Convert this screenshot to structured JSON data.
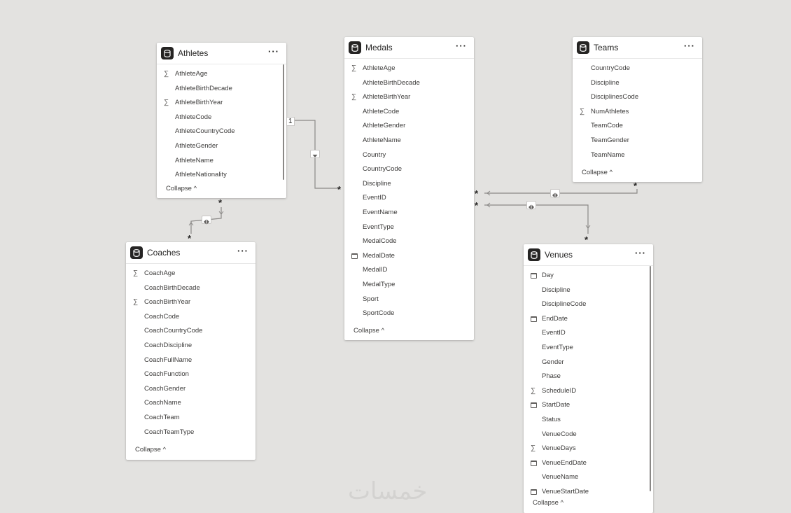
{
  "tables": {
    "athletes": {
      "title": "Athletes",
      "more": "···",
      "collapse": "Collapse",
      "fields": [
        {
          "name": "AthleteAge",
          "icon": "sigma"
        },
        {
          "name": "AthleteBirthDecade",
          "icon": ""
        },
        {
          "name": "AthleteBirthYear",
          "icon": "sigma"
        },
        {
          "name": "AthleteCode",
          "icon": ""
        },
        {
          "name": "AthleteCountryCode",
          "icon": ""
        },
        {
          "name": "AthleteGender",
          "icon": ""
        },
        {
          "name": "AthleteName",
          "icon": ""
        },
        {
          "name": "AthleteNationality",
          "icon": ""
        }
      ]
    },
    "medals": {
      "title": "Medals",
      "more": "···",
      "collapse": "Collapse",
      "fields": [
        {
          "name": "AthleteAge",
          "icon": "sigma"
        },
        {
          "name": "AthleteBirthDecade",
          "icon": ""
        },
        {
          "name": "AthleteBirthYear",
          "icon": "sigma"
        },
        {
          "name": "AthleteCode",
          "icon": ""
        },
        {
          "name": "AthleteGender",
          "icon": ""
        },
        {
          "name": "AthleteName",
          "icon": ""
        },
        {
          "name": "Country",
          "icon": ""
        },
        {
          "name": "CountryCode",
          "icon": ""
        },
        {
          "name": "Discipline",
          "icon": ""
        },
        {
          "name": "EventID",
          "icon": ""
        },
        {
          "name": "EventName",
          "icon": ""
        },
        {
          "name": "EventType",
          "icon": ""
        },
        {
          "name": "MedalCode",
          "icon": ""
        },
        {
          "name": "MedalDate",
          "icon": "calendar"
        },
        {
          "name": "MedalID",
          "icon": ""
        },
        {
          "name": "MedalType",
          "icon": ""
        },
        {
          "name": "Sport",
          "icon": ""
        },
        {
          "name": "SportCode",
          "icon": ""
        }
      ]
    },
    "teams": {
      "title": "Teams",
      "more": "···",
      "collapse": "Collapse",
      "fields": [
        {
          "name": "CountryCode",
          "icon": ""
        },
        {
          "name": "Discipline",
          "icon": ""
        },
        {
          "name": "DisciplinesCode",
          "icon": ""
        },
        {
          "name": "NumAthletes",
          "icon": "sigma"
        },
        {
          "name": "TeamCode",
          "icon": ""
        },
        {
          "name": "TeamGender",
          "icon": ""
        },
        {
          "name": "TeamName",
          "icon": ""
        }
      ]
    },
    "coaches": {
      "title": "Coaches",
      "more": "···",
      "collapse": "Collapse",
      "fields": [
        {
          "name": "CoachAge",
          "icon": "sigma"
        },
        {
          "name": "CoachBirthDecade",
          "icon": ""
        },
        {
          "name": "CoachBirthYear",
          "icon": "sigma"
        },
        {
          "name": "CoachCode",
          "icon": ""
        },
        {
          "name": "CoachCountryCode",
          "icon": ""
        },
        {
          "name": "CoachDiscipline",
          "icon": ""
        },
        {
          "name": "CoachFullName",
          "icon": ""
        },
        {
          "name": "CoachFunction",
          "icon": ""
        },
        {
          "name": "CoachGender",
          "icon": ""
        },
        {
          "name": "CoachName",
          "icon": ""
        },
        {
          "name": "CoachTeam",
          "icon": ""
        },
        {
          "name": "CoachTeamType",
          "icon": ""
        }
      ]
    },
    "venues": {
      "title": "Venues",
      "more": "···",
      "collapse": "Collapse",
      "fields": [
        {
          "name": "Day",
          "icon": "calendar"
        },
        {
          "name": "Discipline",
          "icon": ""
        },
        {
          "name": "DisciplineCode",
          "icon": ""
        },
        {
          "name": "EndDate",
          "icon": "calendar"
        },
        {
          "name": "EventID",
          "icon": ""
        },
        {
          "name": "EventType",
          "icon": ""
        },
        {
          "name": "Gender",
          "icon": ""
        },
        {
          "name": "Phase",
          "icon": ""
        },
        {
          "name": "ScheduleID",
          "icon": "sigma"
        },
        {
          "name": "StartDate",
          "icon": "calendar"
        },
        {
          "name": "Status",
          "icon": ""
        },
        {
          "name": "VenueCode",
          "icon": ""
        },
        {
          "name": "VenueDays",
          "icon": "sigma"
        },
        {
          "name": "VenueEndDate",
          "icon": "calendar"
        },
        {
          "name": "VenueName",
          "icon": ""
        },
        {
          "name": "VenueStartDate",
          "icon": "calendar"
        }
      ]
    }
  },
  "relationships": {
    "many_marker": "*",
    "one_marker": "1"
  },
  "watermark": "خمسات"
}
